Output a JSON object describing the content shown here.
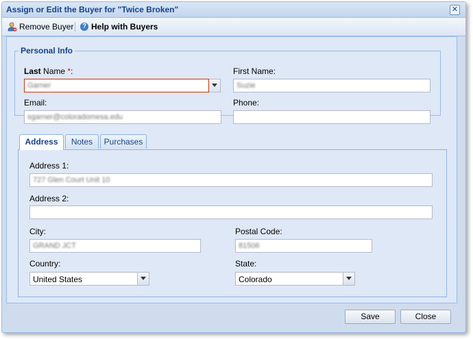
{
  "window": {
    "title": "Assign or Edit the Buyer for \"Twice Broken\"",
    "close_glyph": "✕"
  },
  "toolbar": {
    "remove_label": "Remove Buyer",
    "help_label": "Help with Buyers",
    "help_glyph": "?"
  },
  "personal_info": {
    "legend": "Personal Info",
    "last_name_label_bold": "Last",
    "last_name_label_rest": " Name ",
    "required_mark": "*",
    "last_name_colon": ":",
    "last_name_value": "Garner",
    "first_name_label": "First Name:",
    "first_name_value": "Suzie",
    "email_label": "Email:",
    "email_value": "sgarner@coloradomesa.edu",
    "phone_label": "Phone:",
    "phone_value": ""
  },
  "tabs": [
    {
      "label": "Address",
      "active": true
    },
    {
      "label": "Notes",
      "active": false
    },
    {
      "label": "Purchases",
      "active": false
    }
  ],
  "address": {
    "address1_label": "Address 1:",
    "address1_value": "727 Glen Court Unit 10",
    "address2_label": "Address 2:",
    "address2_value": "",
    "city_label": "City:",
    "city_value": "GRAND JCT",
    "postal_label": "Postal Code:",
    "postal_value": "81506",
    "country_label": "Country:",
    "country_value": "United States",
    "state_label": "State:",
    "state_value": "Colorado"
  },
  "footer": {
    "save_label": "Save",
    "close_label": "Close"
  },
  "colors": {
    "title_text": "#15428b",
    "window_border": "#99bbe8",
    "body_bg": "#dfe8f6",
    "required": "#ee0000",
    "invalid_border": "#cc3300"
  }
}
